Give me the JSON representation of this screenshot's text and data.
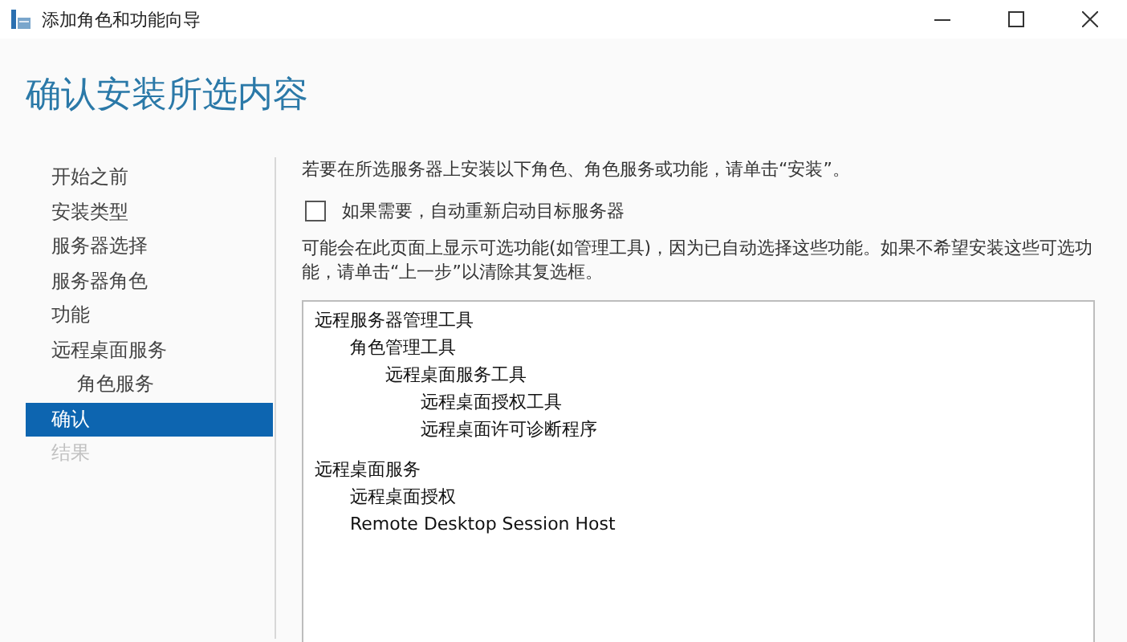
{
  "window": {
    "title": "添加角色和功能向导"
  },
  "heading": "确认安装所选内容",
  "sidebar": {
    "items": [
      {
        "label": "开始之前",
        "selected": false,
        "disabled": false
      },
      {
        "label": "安装类型",
        "selected": false,
        "disabled": false
      },
      {
        "label": "服务器选择",
        "selected": false,
        "disabled": false
      },
      {
        "label": "服务器角色",
        "selected": false,
        "disabled": false
      },
      {
        "label": "功能",
        "selected": false,
        "disabled": false
      },
      {
        "label": "远程桌面服务",
        "selected": false,
        "disabled": false,
        "children": [
          {
            "label": "角色服务",
            "selected": false,
            "disabled": false
          }
        ]
      },
      {
        "label": "确认",
        "selected": true,
        "disabled": false
      },
      {
        "label": "结果",
        "selected": false,
        "disabled": true
      }
    ]
  },
  "intro": "若要在所选服务器上安装以下角色、角色服务或功能，请单击“安装”。",
  "restart_option": {
    "label": "如果需要，自动重新启动目标服务器",
    "checked": false
  },
  "note": "可能会在此页面上显示可选功能(如管理工具)，因为已自动选择这些功能。如果不希望安装这些可选功能，请单击“上一步”以清除其复选框。",
  "selection": [
    {
      "label": "远程服务器管理工具",
      "children": [
        {
          "label": "角色管理工具",
          "children": [
            {
              "label": "远程桌面服务工具",
              "children": [
                {
                  "label": "远程桌面授权工具"
                },
                {
                  "label": "远程桌面许可诊断程序"
                }
              ]
            }
          ]
        }
      ]
    },
    {
      "label": "远程桌面服务",
      "children": [
        {
          "label": "远程桌面授权"
        },
        {
          "label": "Remote Desktop Session Host"
        }
      ]
    }
  ]
}
